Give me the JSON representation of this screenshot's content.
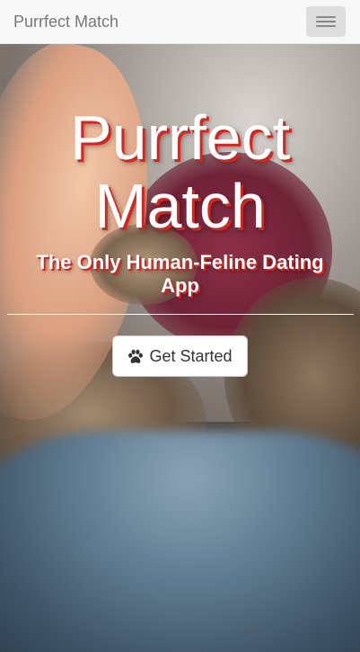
{
  "navbar": {
    "brand": "Purrfect Match",
    "toggle_icon": "hamburger-menu-icon"
  },
  "hero": {
    "title_line1": "Purrfect",
    "title_line2": "Match",
    "subtitle": "The Only Human-Feline Dating App",
    "cta_label": "Get Started",
    "cta_icon": "paw-icon"
  },
  "colors": {
    "navbar_bg": "#f8f8f8",
    "brand_text": "#777777",
    "title_text": "#ffffff",
    "title_shadow": "#d9231d",
    "button_bg": "#ffffff",
    "button_text": "#333333"
  }
}
